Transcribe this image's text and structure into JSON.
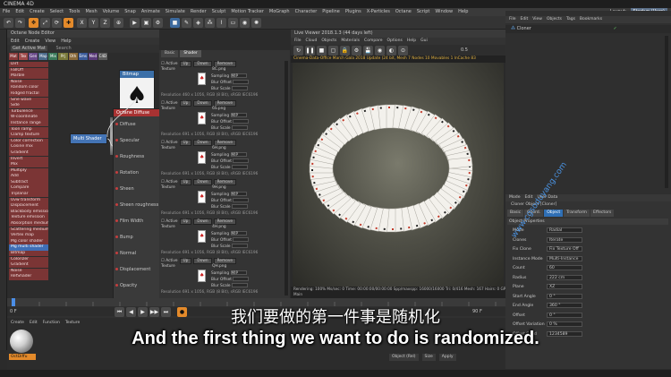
{
  "app": {
    "title": "CINEMA 4D"
  },
  "menubar": {
    "items": [
      "File",
      "Edit",
      "Create",
      "Select",
      "Tools",
      "Mesh",
      "Volume",
      "Snap",
      "Animate",
      "Simulate",
      "Render",
      "Sculpt",
      "Motion Tracker",
      "MoGraph",
      "Character",
      "Pipeline",
      "Plugins",
      "X-Particles",
      "Octane",
      "Script",
      "Window",
      "Help"
    ],
    "layout_label": "Layout:",
    "layout_value": "Startup (User)"
  },
  "node_editor": {
    "tab": "Octane Node Editor",
    "menu": [
      "Edit",
      "Create",
      "View",
      "Help"
    ],
    "search_label": "Get Active Mat",
    "search_placeholder": "Search",
    "color_tabs": [
      {
        "label": "Mat",
        "color": "#8a3a3a"
      },
      {
        "label": "Tex",
        "color": "#a04a4a"
      },
      {
        "label": "Gen",
        "color": "#6a4a8a"
      },
      {
        "label": "Map",
        "color": "#4a6a8a"
      },
      {
        "label": "Mix",
        "color": "#3a7a5a"
      },
      {
        "label": "Prj",
        "color": "#7a7a3a"
      },
      {
        "label": "Oth",
        "color": "#8a6a3a"
      },
      {
        "label": "Ems",
        "color": "#3a5a9a"
      },
      {
        "label": "Med",
        "color": "#5a3a7a"
      },
      {
        "label": "C4D",
        "color": "#5a5a5a"
      }
    ],
    "node_list": [
      "Dirt",
      "FallOff",
      "Marble",
      "Noise",
      "Random color",
      "Ridged fractal",
      "Sine wave",
      "Side",
      "Turbulence",
      "W-coordinate",
      "Instance range",
      "Toon ramp",
      "Clamp texture",
      "Color correction",
      "Cosine mix",
      "Gradient",
      "Invert",
      "Mix",
      "Multiply",
      "Add",
      "Subtract",
      "Compare",
      "Triplanar",
      "Uvw transform",
      "Displacement",
      "Blackbody emission",
      "Texture emission",
      "Absorption medium",
      "Scattering medium",
      "Vertex map",
      "Mg color shader",
      "Mg multi shader",
      "Bitmap",
      "Colorizer",
      "Gradient",
      "Noise",
      "RefShader"
    ],
    "selected_node": "Mg multi shader",
    "bitmap_node_title": "Bitmap",
    "multi_shader_title": "Multi Shader",
    "diffuse_title": "Octane Diffuse",
    "diffuse_ports": [
      "Diffuse",
      "Specular",
      "Roughness",
      "Rotation",
      "Sheen",
      "Sheen roughness",
      "Film Width",
      "Bump",
      "Normal",
      "Displacement",
      "Opacity"
    ]
  },
  "shader_panel": {
    "tabs": [
      "Basic",
      "Shader"
    ],
    "active_tab": "Shader",
    "blocks": [
      {
        "file": "8C.png",
        "res": "Resolution 460 x 1056, RGB (8 Bit), sRGB IEC6196"
      },
      {
        "file": "6S.png",
        "res": "Resolution 691 x 1056, RGB (8 Bit), sRGB IEC6196"
      },
      {
        "file": "6H.png",
        "res": "Resolution 691 x 1056, RGB (8 Bit), sRGB IEC6196"
      },
      {
        "file": "9H.png",
        "res": "Resolution 691 x 1056, RGB (8 Bit), sRGB IEC6196"
      },
      {
        "file": "4H.png",
        "res": "Resolution 691 x 1056, RGB (8 Bit), sRGB IEC6196"
      },
      {
        "file": "QH.png",
        "res": "Resolution 691 x 1056, RGB (8 Bit), sRGB IEC6196"
      }
    ],
    "active_label": "Active",
    "texture_label": "Texture",
    "sampling_label": "Sampling",
    "sampling_value": "MIP",
    "blur_offset_label": "Blur Offset",
    "blur_scale_label": "Blur Scale",
    "up_label": "Up",
    "down_label": "Down",
    "remove_label": "Remove"
  },
  "live_viewer": {
    "title": "Live Viewer 2018.1.3 (44 days left)",
    "menu": [
      "File",
      "Cloud",
      "Objects",
      "Materials",
      "Compare",
      "Options",
      "Help",
      "Gui"
    ],
    "status_line": "Cinema-Data-Office March Gala 2018 Update (24 bit, Mesh 7 Nodes 10 Movables 1 InCache 83",
    "render_label": "Rendering",
    "render_stats": "Rendering: 100%  Ms/sec: 0  Time: 00:00:00/00:00:00  Spp/maxspp: 16000/16000  Tri: 0/416  Mesh: 167  Hairs: 0  GPU: 56",
    "bottom_text": "Main",
    "zoom_value": "0.5"
  },
  "object_manager": {
    "menu": [
      "File",
      "Edit",
      "View",
      "Objects",
      "Tags",
      "Bookmarks"
    ],
    "object_name": "Cloner"
  },
  "attributes": {
    "menu": [
      "Mode",
      "Edit",
      "User Data"
    ],
    "title": "Cloner Object [Cloner]",
    "tabs": [
      "Basic",
      "Coord.",
      "Object",
      "Transform",
      "Effectors"
    ],
    "active_tab": "Object",
    "section": "Object Properties",
    "rows": [
      {
        "label": "Mode",
        "value": "Radial"
      },
      {
        "label": "Clones",
        "value": "Iterate"
      },
      {
        "label": "Fix Clone",
        "value": "Fix Texture  Off"
      },
      {
        "label": "Instance Mode",
        "value": "Multi-Instance"
      },
      {
        "label": "Count",
        "value": "60"
      },
      {
        "label": "Radius",
        "value": "222 cm"
      },
      {
        "label": "Plane",
        "value": "XZ"
      },
      {
        "label": "Start Angle",
        "value": "0 °"
      },
      {
        "label": "End Angle",
        "value": "360 °"
      },
      {
        "label": "Offset",
        "value": "0 °"
      },
      {
        "label": "Offset Variation",
        "value": "0 %"
      },
      {
        "label": "Offset Seed",
        "value": "1234589"
      }
    ]
  },
  "timeline": {
    "start_frame": "0 F",
    "end_frame": "90 F"
  },
  "material_manager": {
    "menu": [
      "Create",
      "Edit",
      "Function",
      "Texture"
    ],
    "material_name": "OctDiffu"
  },
  "coord_bar": {
    "items": [
      "Object (Rel)",
      "Size",
      "Apply"
    ]
  },
  "subtitles": {
    "cn": "我们要做的第一件事是随机化",
    "en": "And the first thing we want to do is randomized."
  },
  "watermark": "www.cgsoduyang.com"
}
